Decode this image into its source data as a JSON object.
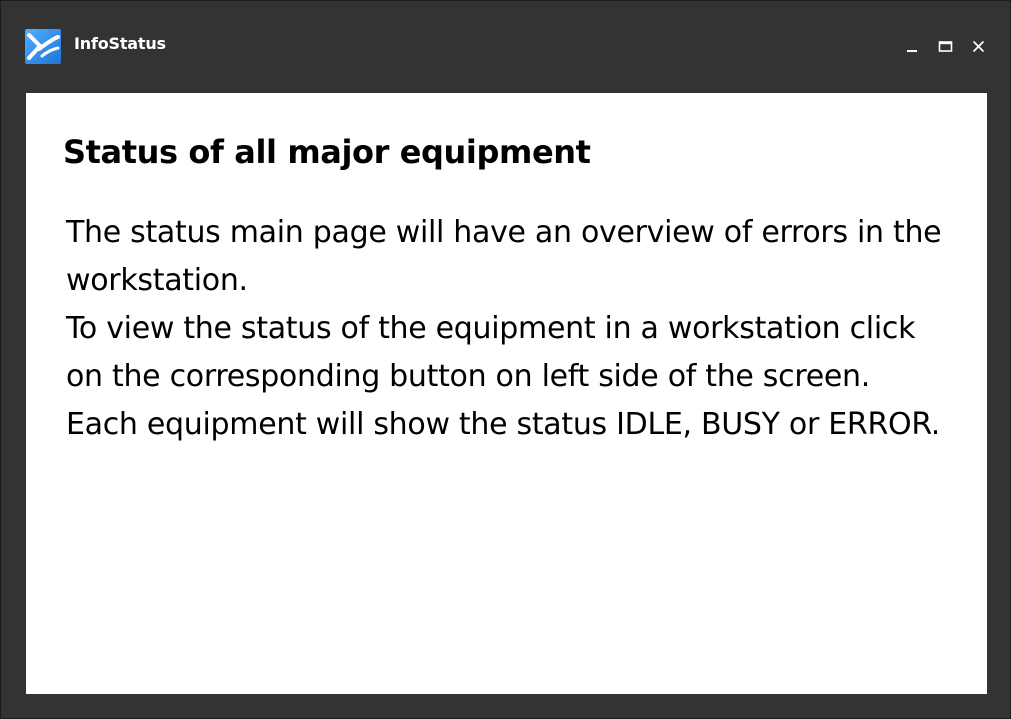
{
  "window": {
    "title": "InfoStatus",
    "app_icon": "infostatus-logo-icon",
    "controls": {
      "minimize_icon": "minimize-icon",
      "maximize_icon": "maximize-icon",
      "close_icon": "close-icon"
    }
  },
  "main": {
    "title": "Status of all major equipment",
    "paragraphs": [
      "The status main page will have an overview of errors in the workstation.",
      "To view the status of the equipment in a workstation click on the corresponding button on left side of the screen.",
      "Each equipment will show the status IDLE, BUSY or ERROR."
    ]
  },
  "colors": {
    "chrome_background": "#333333",
    "content_background": "#ffffff",
    "logo_blue": "#2b8fe8",
    "text": "#000000",
    "title_text": "#ffffff"
  }
}
